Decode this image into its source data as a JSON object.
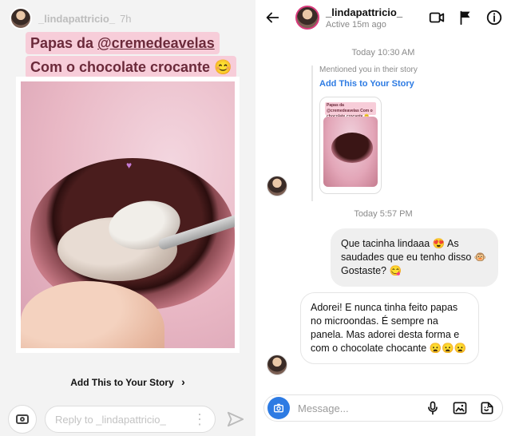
{
  "story": {
    "username": "_lindapattricio_",
    "time": "7h",
    "caption_line1_prefix": "Papas da ",
    "caption_mention": "@cremedeavelas",
    "caption_line2": "Com o chocolate crocante 😊",
    "add_to_story": "Add This to Your Story",
    "reply_placeholder": "Reply to _lindapattricio_"
  },
  "chat": {
    "header": {
      "name": "_lindapattricio_",
      "status": "Active 15m ago"
    },
    "timestamps": {
      "t1": "Today 10:30 AM",
      "t2": "Today 5:57 PM"
    },
    "mention_card": {
      "text": "Mentioned you in their story",
      "cta": "Add This to Your Story",
      "mini_caption": "Papas da @cremedeavelas Com o chocolate crocante 😊"
    },
    "messages": [
      {
        "from": "me",
        "text": "Que tacinha lindaaa 😍 As saudades que eu tenho disso 🐵 Gostaste? 😋"
      },
      {
        "from": "them",
        "text": "Adorei! E nunca tinha feito papas no microondas. É sempre na panela. Mas adorei desta forma e com o chocolate chocante 😦😦😦"
      }
    ],
    "composer": {
      "placeholder": "Message..."
    }
  },
  "colors": {
    "accent_blue": "#2d7be3",
    "caption_bg": "#f7cdd9",
    "caption_text": "#6b2a3a",
    "gray_text": "#8a8a8a"
  }
}
